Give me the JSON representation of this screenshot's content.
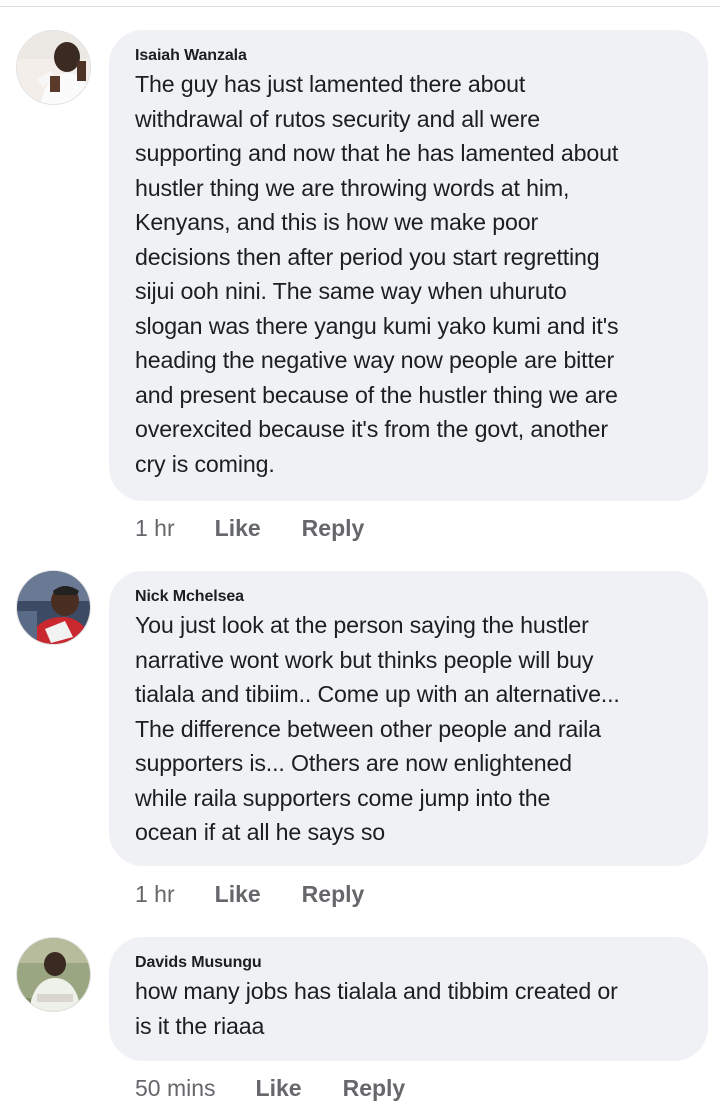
{
  "comments": [
    {
      "author": "Isaiah Wanzala",
      "text": "The guy has just lamented there about\nwithdrawal of rutos security and all were\nsupporting and now that he has lamented about\nhustler thing we are throwing words at him,\nKenyans, and this is how we make poor\ndecisions then after period you start regretting\nsijui ooh nini. The same way when uhuruto\nslogan was there yangu kumi yako kumi and it's\nheading the negative way now people are bitter\nand present because of the hustler thing we are\noverexcited because it's from the govt, another\ncry is coming.",
      "time": "1 hr",
      "like_label": "Like",
      "reply_label": "Reply"
    },
    {
      "author": "Nick Mchelsea",
      "text": "You just look at the person saying the hustler\nnarrative wont work but thinks people will buy\ntialala and tibiim.. Come up with an alternative...\nThe difference between other people and raila\nsupporters is... Others are now enlightened\nwhile raila supporters come jump into the\nocean if at all he says so",
      "time": "1 hr",
      "like_label": "Like",
      "reply_label": "Reply"
    },
    {
      "author": "Davids Musungu",
      "text": "how many jobs has tialala and tibbim created or\nis it the riaaa",
      "time": "50 mins",
      "like_label": "Like",
      "reply_label": "Reply"
    }
  ],
  "colors": {
    "bubble_bg": "#f0f1f5",
    "meta_text": "#65676b",
    "primary_text": "#1c1e21"
  }
}
